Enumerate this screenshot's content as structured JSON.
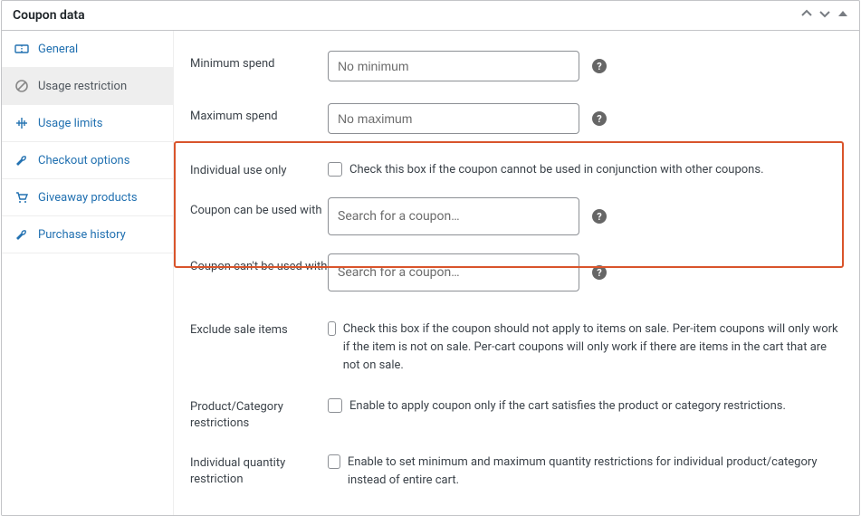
{
  "panel_title": "Coupon data",
  "sidebar": {
    "items": [
      {
        "label": "General"
      },
      {
        "label": "Usage restriction"
      },
      {
        "label": "Usage limits"
      },
      {
        "label": "Checkout options"
      },
      {
        "label": "Giveaway products"
      },
      {
        "label": "Purchase history"
      }
    ]
  },
  "fields": {
    "min_spend": {
      "label": "Minimum spend",
      "placeholder": "No minimum"
    },
    "max_spend": {
      "label": "Maximum spend",
      "placeholder": "No maximum"
    },
    "individual_use": {
      "label": "Individual use only",
      "text": "Check this box if the coupon cannot be used in conjunction with other coupons."
    },
    "coupon_can": {
      "label": "Coupon can be used with",
      "placeholder": "Search for a coupon…"
    },
    "coupon_cant": {
      "label": "Coupon can't be used with",
      "placeholder": "Search for a coupon…"
    },
    "exclude_sale": {
      "label": "Exclude sale items",
      "text": "Check this box if the coupon should not apply to items on sale. Per-item coupons will only work if the item is not on sale. Per-cart coupons will only work if there are items in the cart that are not on sale."
    },
    "prod_cat": {
      "label": "Product/Category restrictions",
      "text": "Enable to apply coupon only if the cart satisfies the product or category restrictions."
    },
    "indiv_qty": {
      "label": "Individual quantity restriction",
      "text": "Enable to set minimum and maximum quantity restrictions for individual product/category instead of entire cart."
    }
  }
}
